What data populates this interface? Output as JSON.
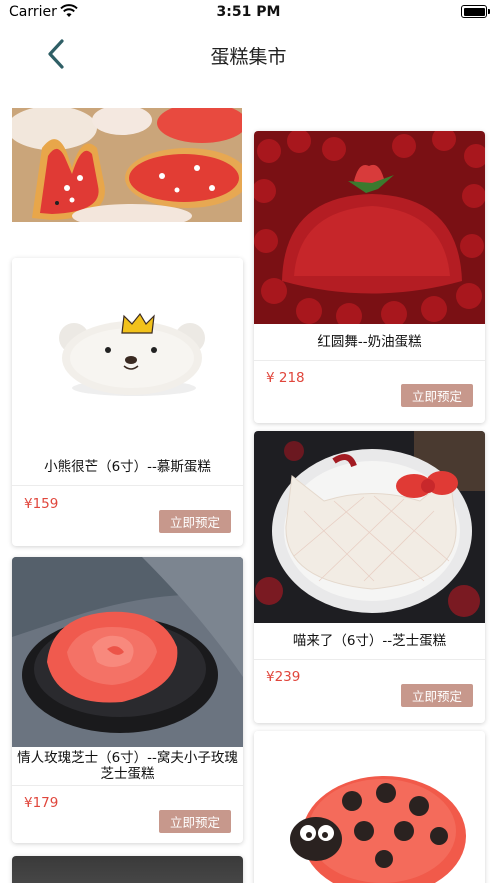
{
  "status_bar": {
    "carrier": "Carrier",
    "time": "3:51 PM"
  },
  "nav": {
    "title": "蛋糕集市",
    "back_icon": "chevron-left-icon"
  },
  "button_label": "立即预定",
  "products": [
    {
      "name": "红圆舞--奶油蛋糕",
      "price": "¥ 218"
    },
    {
      "name": "小熊很芒（6寸）--慕斯蛋糕",
      "price": "¥159"
    },
    {
      "name": "喵来了（6寸）--芝士蛋糕",
      "price": "¥239"
    },
    {
      "name": "情人玫瑰芝士（6寸）--窝夫小子玫瑰芝士蛋糕",
      "price": "¥179"
    }
  ],
  "colors": {
    "price": "#e0463c",
    "button": "#c7988c",
    "back_icon": "#2f5f66"
  }
}
